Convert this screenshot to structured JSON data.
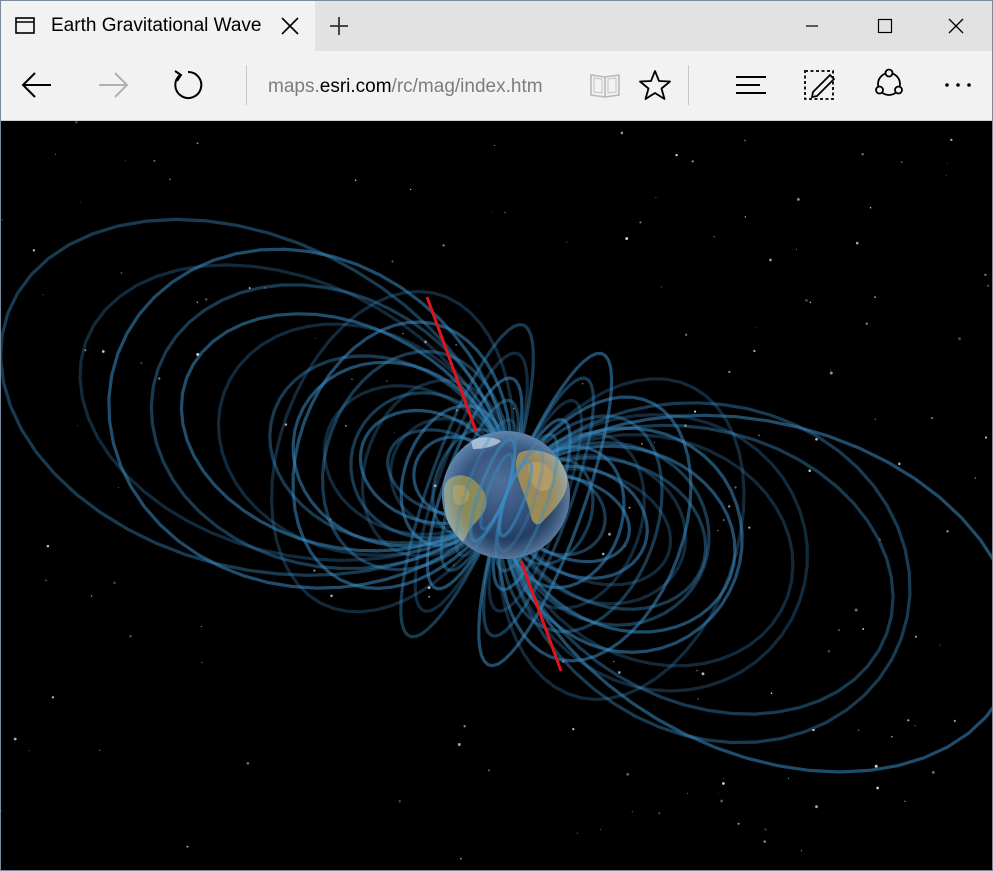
{
  "tab": {
    "title": "Earth Gravitational Wave",
    "icon": "tab-page-icon"
  },
  "address_bar": {
    "url_prefix": "maps.",
    "url_host": "esri.com",
    "url_path": "/rc/mag/index.htm"
  },
  "icons": {
    "back": "back-arrow-icon",
    "forward": "forward-arrow-icon",
    "refresh": "refresh-icon",
    "reading_view": "book-icon",
    "favorite": "star-icon",
    "hub": "hub-icon",
    "web_note": "web-note-icon",
    "share": "share-icon",
    "more": "more-icon"
  },
  "colors": {
    "field_lines": "#3a8cc4",
    "axis": "#e0141e",
    "space": "#000000"
  }
}
